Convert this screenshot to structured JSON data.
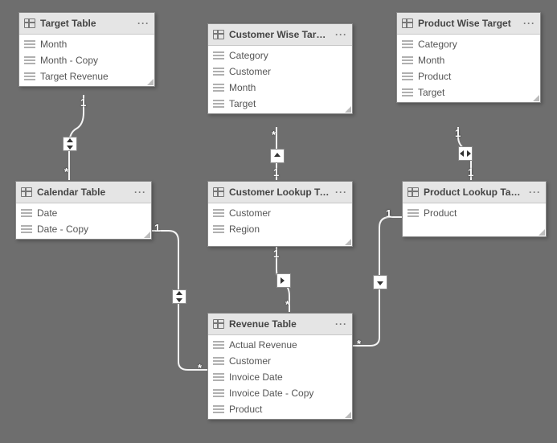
{
  "ui": {
    "more_label": "···"
  },
  "tables": {
    "target": {
      "title": "Target Table",
      "fields": [
        "Month",
        "Month - Copy",
        "Target Revenue"
      ]
    },
    "custwise": {
      "title": "Customer Wise Target",
      "fields": [
        "Category",
        "Customer",
        "Month",
        "Target"
      ]
    },
    "prodwise": {
      "title": "Product Wise Target",
      "fields": [
        "Category",
        "Month",
        "Product",
        "Target"
      ]
    },
    "calendar": {
      "title": "Calendar Table",
      "fields": [
        "Date",
        "Date - Copy"
      ]
    },
    "custlk": {
      "title": "Customer Lookup Ta...",
      "fields": [
        "Customer",
        "Region"
      ]
    },
    "prodlk": {
      "title": "Product Lookup Table",
      "fields": [
        "Product"
      ]
    },
    "revenue": {
      "title": "Revenue Table",
      "fields": [
        "Actual Revenue",
        "Customer",
        "Invoice Date",
        "Invoice Date - Copy",
        "Product"
      ]
    }
  },
  "relationships": [
    {
      "from": "target",
      "to": "calendar",
      "from_card": "1",
      "to_card": "*",
      "filter": "both"
    },
    {
      "from": "custwise",
      "to": "custlk",
      "from_card": "*",
      "to_card": "1",
      "filter": "single"
    },
    {
      "from": "prodwise",
      "to": "prodlk",
      "from_card": "1",
      "to_card": "1",
      "filter": "both"
    },
    {
      "from": "calendar",
      "to": "revenue",
      "from_card": "1",
      "to_card": "*",
      "filter": "both"
    },
    {
      "from": "custlk",
      "to": "revenue",
      "from_card": "1",
      "to_card": "*",
      "filter": "single"
    },
    {
      "from": "prodlk",
      "to": "revenue",
      "from_card": "1",
      "to_card": "*",
      "filter": "single"
    }
  ]
}
